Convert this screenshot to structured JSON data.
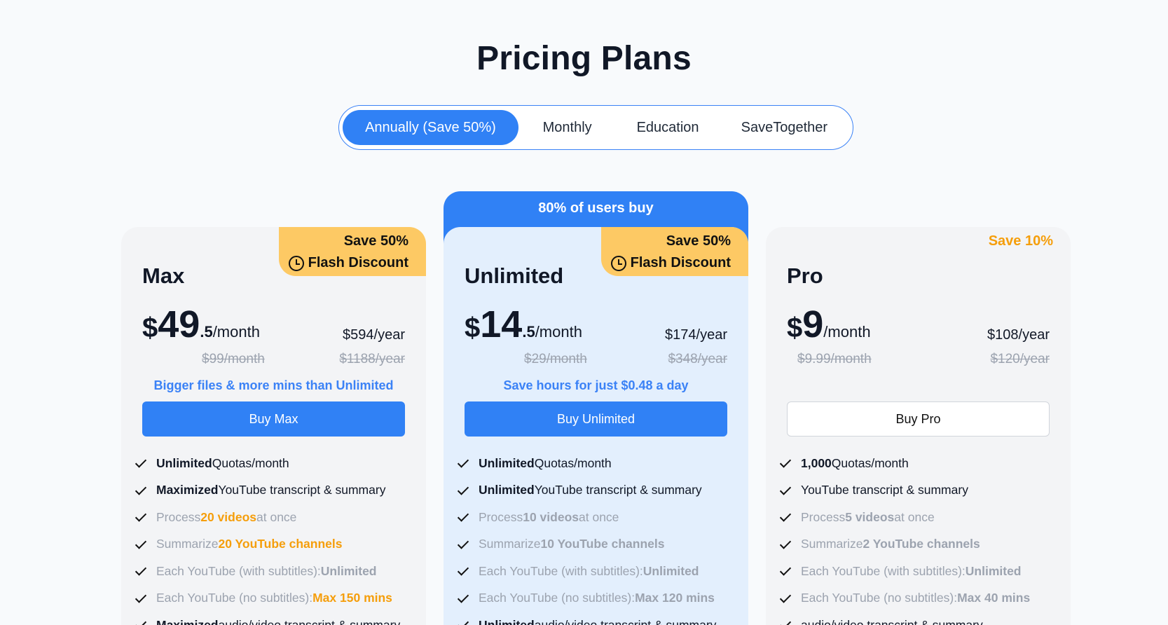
{
  "title": "Pricing Plans",
  "tabs": [
    "Annually (Save 50%)",
    "Monthly",
    "Education",
    "SaveTogether"
  ],
  "plans": [
    {
      "name": "Max",
      "badge1": "Save 50%",
      "badge2": "Flash Discount",
      "currency": "$",
      "price_int": "49",
      "price_dec": ".5",
      "per": "/month",
      "year": "$594/year",
      "old_month": "$99/month",
      "old_year": "$1188/year",
      "tagline": "Bigger files & more mins than Unlimited",
      "button": "Buy Max",
      "features": [
        {
          "a": "Unlimited",
          "b": " Quotas/month"
        },
        {
          "a": "Maximized",
          "b": " YouTube transcript & summary"
        },
        {
          "a": "Process ",
          "b": "20 videos",
          "c": " at once"
        },
        {
          "a": "Summarize ",
          "b": "20 YouTube channels"
        },
        {
          "a": "Each YouTube (with subtitles): ",
          "b": "Unlimited"
        },
        {
          "a": "Each YouTube (no subtitles): ",
          "b": "Max 150 mins"
        },
        {
          "a": "Maximized",
          "b": " audio/video transcript & summary"
        }
      ]
    },
    {
      "name": "Unlimited",
      "banner": "80% of users buy",
      "badge1": "Save 50%",
      "badge2": "Flash Discount",
      "currency": "$",
      "price_int": "14",
      "price_dec": ".5",
      "per": "/month",
      "year": "$174/year",
      "old_month": "$29/month",
      "old_year": "$348/year",
      "tagline": "Save hours for just $0.48 a day",
      "button": "Buy Unlimited",
      "features": [
        {
          "a": "Unlimited",
          "b": " Quotas/month"
        },
        {
          "a": "Unlimited",
          "b": " YouTube transcript & summary"
        },
        {
          "a": "Process ",
          "b": "10 videos",
          "c": " at once"
        },
        {
          "a": "Summarize ",
          "b": "10 YouTube channels"
        },
        {
          "a": "Each YouTube (with subtitles): ",
          "b": "Unlimited"
        },
        {
          "a": "Each YouTube (no subtitles): ",
          "b": "Max 120 mins"
        },
        {
          "a": "Unlimited",
          "b": " audio/video transcript & summary"
        }
      ]
    },
    {
      "name": "Pro",
      "badge1": "Save 10%",
      "currency": "$",
      "price_int": "9",
      "per": "/month",
      "year": "$108/year",
      "old_month": "$9.99/month",
      "old_year": "$120/year",
      "button": "Buy Pro",
      "features": [
        {
          "a": "1,000",
          "b": " Quotas/month"
        },
        {
          "a": "YouTube transcript & summary"
        },
        {
          "a": "Process ",
          "b": "5 videos",
          "c": " at once"
        },
        {
          "a": "Summarize ",
          "b": "2 YouTube channels"
        },
        {
          "a": "Each YouTube (with subtitles): ",
          "b": "Unlimited"
        },
        {
          "a": "Each YouTube (no subtitles): ",
          "b": "Max 40 mins"
        },
        {
          "a": "audio/video transcript & summary"
        }
      ]
    }
  ]
}
